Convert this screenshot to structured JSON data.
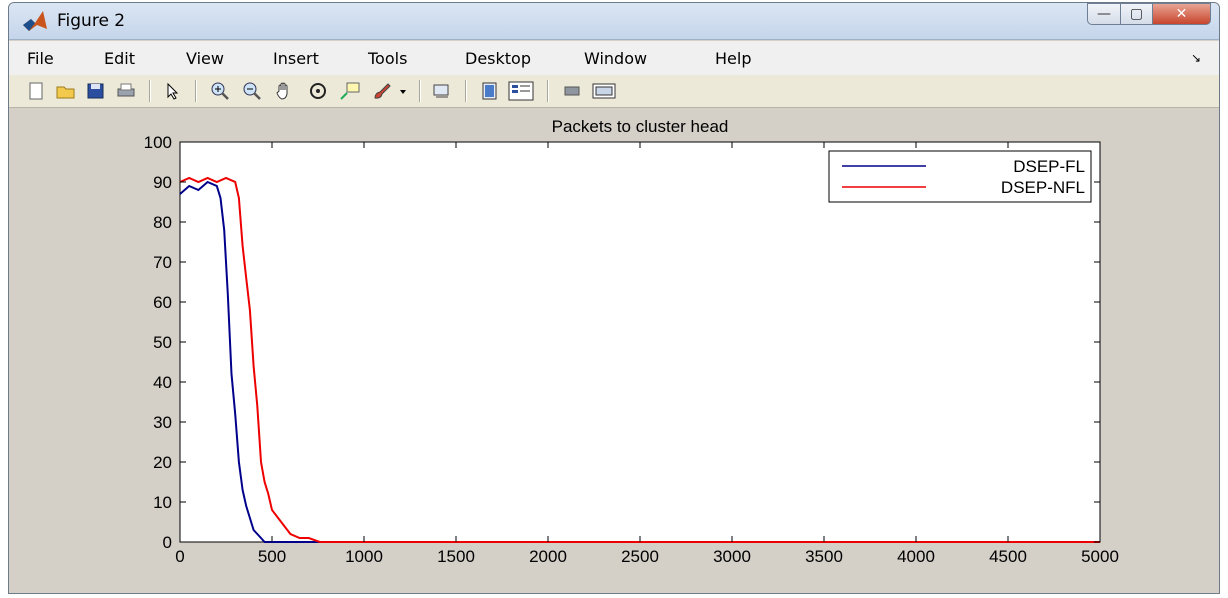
{
  "window": {
    "title": "Figure 2",
    "controls": {
      "minimize": "—",
      "maximize": "▢",
      "close": "✕"
    }
  },
  "menu": {
    "items": [
      "File",
      "Edit",
      "View",
      "Insert",
      "Tools",
      "Desktop",
      "Window",
      "Help"
    ],
    "overflow": "↘"
  },
  "toolbar": {
    "icons": [
      "new-figure-icon",
      "open-file-icon",
      "save-icon",
      "print-icon",
      "select-arrow-icon",
      "zoom-in-icon",
      "zoom-out-icon",
      "pan-hand-icon",
      "rotate-3d-icon",
      "data-cursor-icon",
      "brush-icon",
      "brush-dropdown-icon",
      "link-plot-icon",
      "colorbar-icon",
      "legend-icon",
      "hide-plot-tools-icon",
      "show-plot-tools-icon"
    ]
  },
  "colors": {
    "series_fl": "#00008b",
    "series_nfl": "#ee0000",
    "figure_bg": "#d4d0c8"
  },
  "chart_data": {
    "type": "line",
    "title": "Packets to cluster head",
    "xlabel": "",
    "ylabel": "",
    "xlim": [
      0,
      5000
    ],
    "ylim": [
      0,
      100
    ],
    "xticks": [
      "0",
      "500",
      "1000",
      "1500",
      "2000",
      "2500",
      "3000",
      "3500",
      "4000",
      "4500",
      "5000"
    ],
    "yticks": [
      "0",
      "10",
      "20",
      "30",
      "40",
      "50",
      "60",
      "70",
      "80",
      "90",
      "100"
    ],
    "grid": false,
    "legend": "top-right",
    "series": [
      {
        "name": "DSEP-FL",
        "color": "#00008b",
        "x": [
          0,
          50,
          100,
          150,
          200,
          220,
          240,
          260,
          280,
          300,
          320,
          340,
          360,
          380,
          400,
          420,
          440,
          460,
          5000
        ],
        "y": [
          87,
          89,
          88,
          90,
          89,
          86,
          78,
          62,
          42,
          32,
          20,
          13,
          9,
          6,
          3,
          2,
          1,
          0,
          0
        ]
      },
      {
        "name": "DSEP-NFL",
        "color": "#ee0000",
        "x": [
          0,
          50,
          100,
          150,
          200,
          250,
          300,
          320,
          340,
          360,
          380,
          400,
          420,
          440,
          460,
          480,
          500,
          550,
          600,
          650,
          700,
          760,
          5000
        ],
        "y": [
          90,
          91,
          90,
          91,
          90,
          91,
          90,
          86,
          74,
          66,
          58,
          44,
          34,
          20,
          15,
          12,
          8,
          5,
          2,
          1,
          1,
          0,
          0
        ]
      }
    ]
  }
}
